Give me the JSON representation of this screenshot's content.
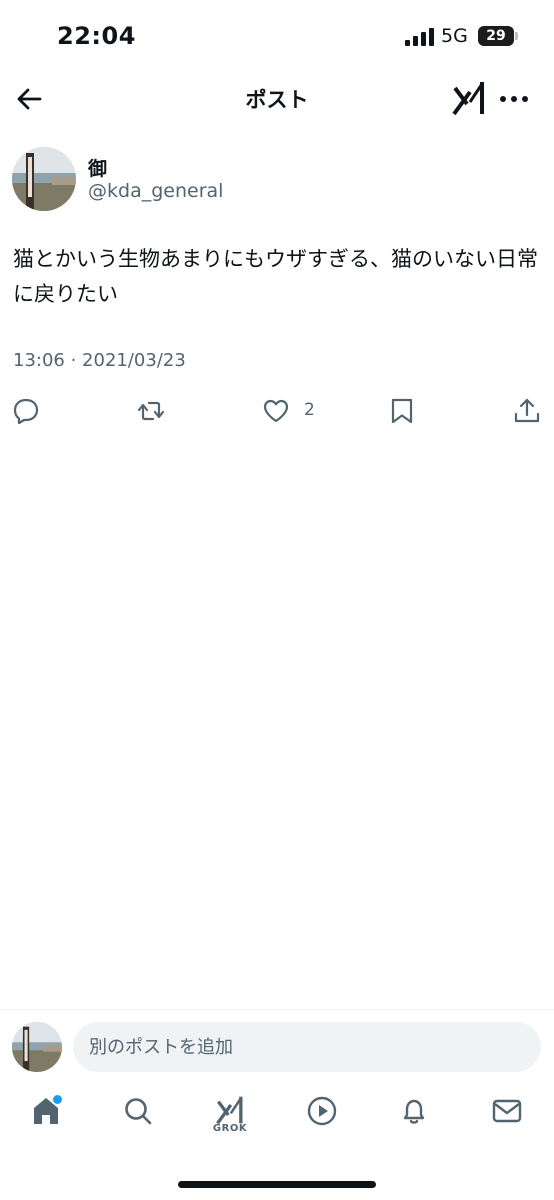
{
  "status_bar": {
    "time": "22:04",
    "network": "5G",
    "battery": "29"
  },
  "header": {
    "title": "ポスト",
    "back_icon": "arrow-left-icon",
    "grok_icon": "grok-icon",
    "more_icon": "more-horizontal-icon"
  },
  "post": {
    "author_name": "御",
    "author_handle": "@kda_general",
    "text": "猫とかいう生物あまりにもウザすぎる、猫のいない日常に戻りたい",
    "timestamp": "13:06 · 2021/03/23",
    "actions": {
      "reply_icon": "reply-icon",
      "repost_icon": "repost-icon",
      "like_icon": "heart-icon",
      "like_count": "2",
      "bookmark_icon": "bookmark-icon",
      "share_icon": "share-icon"
    }
  },
  "reply_bar": {
    "placeholder": "別のポストを追加"
  },
  "tab_bar": {
    "items": [
      "home-icon",
      "search-icon",
      "grok-icon",
      "video-icon",
      "notifications-icon",
      "messages-icon"
    ],
    "grok_label": "GROK"
  },
  "colors": {
    "text_primary": "#0f1419",
    "text_secondary": "#536471",
    "accent": "#1d9bf0",
    "input_bg": "#eff3f4"
  }
}
